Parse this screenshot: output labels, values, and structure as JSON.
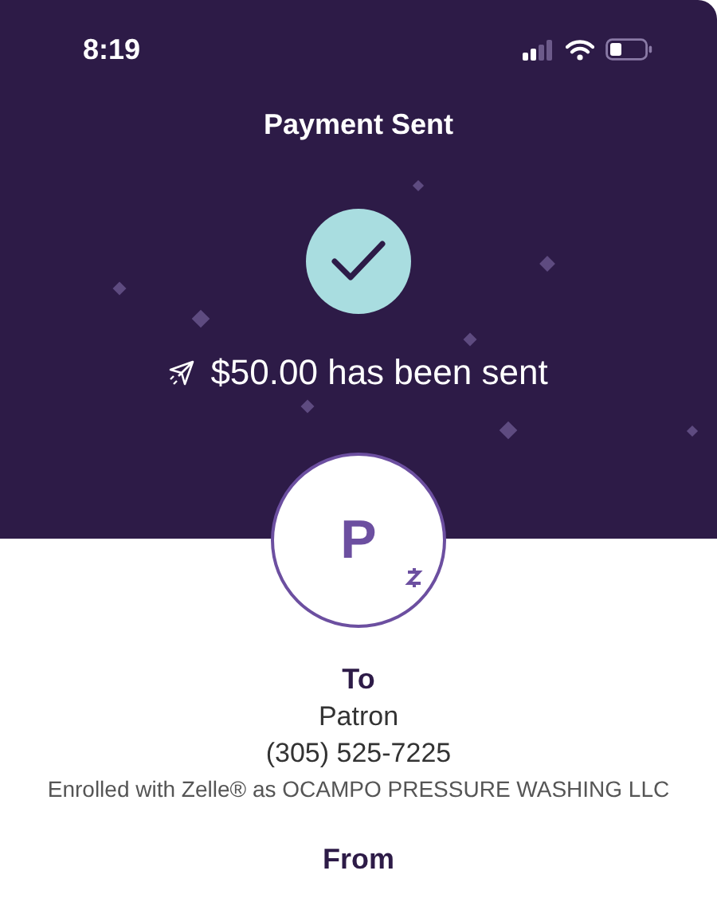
{
  "status_bar": {
    "time": "8:19"
  },
  "header": {
    "title": "Payment Sent",
    "message": "$50.00 has been sent"
  },
  "recipient": {
    "initial": "P",
    "label": "To",
    "name": "Patron",
    "phone": "(305) 525-7225",
    "enrollment": "Enrolled with Zelle® as OCAMPO PRESSURE WASHING LLC"
  },
  "sender": {
    "label": "From"
  }
}
